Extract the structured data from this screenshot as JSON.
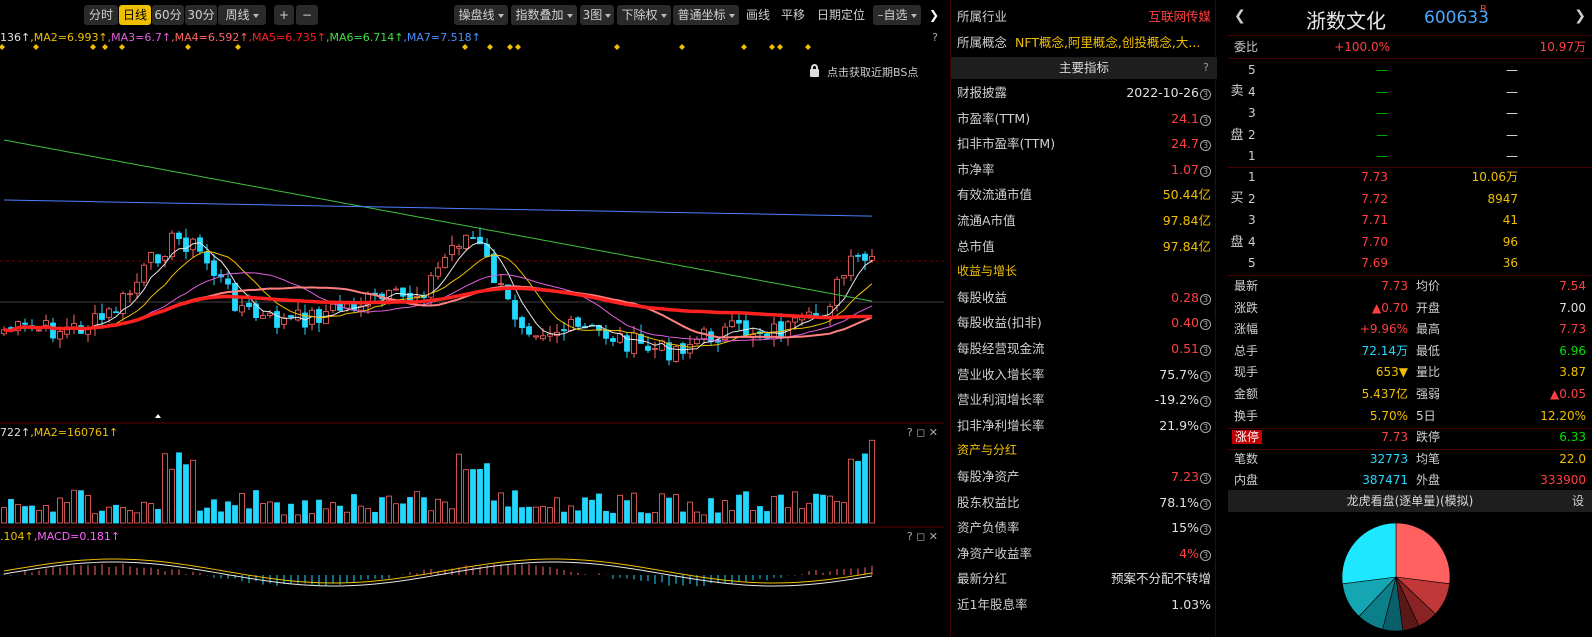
{
  "toolbar": {
    "period_tabs": [
      "分时",
      "日线",
      "60分",
      "30分",
      "周线"
    ],
    "active_period": "日线",
    "zoom_in": "+",
    "zoom_out": "−",
    "menus": [
      "操盘线",
      "指数叠加",
      "3图",
      "下除权",
      "普通坐标"
    ],
    "tools": [
      "画线",
      "平移",
      "日期定位"
    ],
    "watchlist": "自选",
    "collapse": "❯"
  },
  "kline": {
    "ma_legend": [
      {
        "text": "136↑",
        "color": "#e0e0e0"
      },
      {
        "text": ",MA2=6.993↑",
        "color": "#f0c000"
      },
      {
        "text": ",MA3=6.7↑",
        "color": "#e060e0"
      },
      {
        "text": ",MA4=6.592↑",
        "color": "#ff6666"
      },
      {
        "text": ",MA5=6.735↑",
        "color": "#ff2020"
      },
      {
        "text": ",MA6=6.714↑",
        "color": "#40e040"
      },
      {
        "text": ",MA7=7.518↑",
        "color": "#4a90ff"
      }
    ],
    "panel_help": "?",
    "bs_hint": "点击获取近期BS点"
  },
  "volume": {
    "legend": [
      {
        "text": "722↑",
        "color": "#e0e0e0"
      },
      {
        "text": ",MA2=160761↑",
        "color": "#f0c000"
      }
    ],
    "controls": "? ◻ ✕"
  },
  "macd": {
    "legend": [
      {
        "text": ".104↑",
        "color": "#f0c000"
      },
      {
        "text": ",MACD=0.181↑",
        "color": "#ff60ff"
      }
    ],
    "controls": "? ◻ ✕"
  },
  "mid": {
    "industry_label": "所属行业",
    "industry_value": "互联网传媒",
    "concept_label": "所属概念",
    "concept_value": "NFT概念,阿里概念,创投概念,大...",
    "key_indicators": "主要指标",
    "help": "?",
    "rows": [
      {
        "label": "财报披露",
        "value": "2022-10-26",
        "color": "white",
        "circ": "3"
      },
      {
        "label": "市盈率(TTM)",
        "value": "24.1",
        "color": "red",
        "circ": "3"
      },
      {
        "label": "扣非市盈率(TTM)",
        "value": "24.7",
        "color": "red",
        "circ": "3"
      },
      {
        "label": "市净率",
        "value": "1.07",
        "color": "red",
        "circ": "3"
      },
      {
        "label": "有效流通市值",
        "value": "50.44亿",
        "color": "yellow",
        "circ": ""
      },
      {
        "label": "流通A市值",
        "value": "97.84亿",
        "color": "yellow",
        "circ": ""
      },
      {
        "label": "总市值",
        "value": "97.84亿",
        "color": "yellow",
        "circ": ""
      }
    ],
    "growth_title": "收益与增长",
    "growth_rows": [
      {
        "label": "每股收益",
        "value": "0.28",
        "color": "red",
        "circ": "3"
      },
      {
        "label": "每股收益(扣非)",
        "value": "0.40",
        "color": "red",
        "circ": "3"
      },
      {
        "label": "每股经营现金流",
        "value": "0.51",
        "color": "red",
        "circ": "3"
      },
      {
        "label": "营业收入增长率",
        "value": "75.7%",
        "color": "white",
        "circ": "3"
      },
      {
        "label": "营业利润增长率",
        "value": "-19.2%",
        "color": "white",
        "circ": "3"
      },
      {
        "label": "扣非净利增长率",
        "value": "21.9%",
        "color": "white",
        "circ": "3"
      }
    ],
    "asset_title": "资产与分红",
    "asset_rows": [
      {
        "label": "每股净资产",
        "value": "7.23",
        "color": "red",
        "circ": "3"
      },
      {
        "label": "股东权益比",
        "value": "78.1%",
        "color": "white",
        "circ": "3"
      },
      {
        "label": "资产负债率",
        "value": "15%",
        "color": "white",
        "circ": "3"
      },
      {
        "label": "净资产收益率",
        "value": "4%",
        "color": "red",
        "circ": "3"
      },
      {
        "label": "最新分红",
        "value": "预案不分配不转增",
        "color": "white",
        "circ": ""
      },
      {
        "label": "近1年股息率",
        "value": "1.03%",
        "color": "white",
        "circ": ""
      }
    ]
  },
  "right": {
    "stock_name": "浙数文化",
    "stock_code": "600633",
    "stock_flag": "R",
    "back": "❮",
    "forward": "❯",
    "weibi_label": "委比",
    "weibi_value": "+100.0%",
    "weicha_value": "10.97万",
    "sell_side": "卖盘",
    "buy_side": "买盘",
    "sell_levels": [
      {
        "level": "5",
        "price": "—",
        "vol": "—"
      },
      {
        "level": "4",
        "price": "—",
        "vol": "—"
      },
      {
        "level": "3",
        "price": "—",
        "vol": "—"
      },
      {
        "level": "2",
        "price": "—",
        "vol": "—"
      },
      {
        "level": "1",
        "price": "—",
        "vol": "—"
      }
    ],
    "buy_levels": [
      {
        "level": "1",
        "price": "7.73",
        "vol": "10.06万"
      },
      {
        "level": "2",
        "price": "7.72",
        "vol": "8947"
      },
      {
        "level": "3",
        "price": "7.71",
        "vol": "41"
      },
      {
        "level": "4",
        "price": "7.70",
        "vol": "96"
      },
      {
        "level": "5",
        "price": "7.69",
        "vol": "36"
      }
    ],
    "quotes": [
      {
        "l1": "最新",
        "v1": "7.73",
        "c1": "red",
        "l2": "均价",
        "v2": "7.54",
        "c2": "red"
      },
      {
        "l1": "涨跌",
        "v1": "▲0.70",
        "c1": "red",
        "l2": "开盘",
        "v2": "7.00",
        "c2": "white"
      },
      {
        "l1": "涨幅",
        "v1": "+9.96%",
        "c1": "red",
        "l2": "最高",
        "v2": "7.73",
        "c2": "red"
      },
      {
        "l1": "总手",
        "v1": "72.14万",
        "c1": "cyan",
        "l2": "最低",
        "v2": "6.96",
        "c2": "green"
      },
      {
        "l1": "现手",
        "v1": "653▼",
        "c1": "yellow",
        "l2": "量比",
        "v2": "3.87",
        "c2": "yellow"
      },
      {
        "l1": "金额",
        "v1": "5.437亿",
        "c1": "yellow",
        "l2": "强弱",
        "v2": "▲0.05",
        "c2": "red"
      },
      {
        "l1": "换手",
        "v1": "5.70%",
        "c1": "yellow",
        "l2": "5日",
        "v2": "12.20%",
        "c2": "yellow"
      }
    ],
    "limit_up_label": "涨停",
    "limit_up_value": "7.73",
    "limit_down_label": "跌停",
    "limit_down_value": "6.33",
    "trades_label": "笔数",
    "trades_value": "32773",
    "avg_label": "均笔",
    "avg_value": "22.0",
    "inner_label": "内盘",
    "inner_value": "387471",
    "outer_label": "外盘",
    "outer_value": "333900",
    "lhk_title": "龙虎看盘(逐单量)(模拟)",
    "lhk_setting": "设"
  },
  "pie": {
    "slices": [
      {
        "value": 27,
        "color": "#ff6060"
      },
      {
        "value": 10,
        "color": "#c03838"
      },
      {
        "value": 6,
        "color": "#8a2424"
      },
      {
        "value": 5,
        "color": "#5a1818"
      },
      {
        "value": 6,
        "color": "#0b5f68"
      },
      {
        "value": 8,
        "color": "#0d7f8a"
      },
      {
        "value": 11,
        "color": "#14a6b2"
      },
      {
        "value": 27,
        "color": "#1ee8ff"
      }
    ]
  }
}
